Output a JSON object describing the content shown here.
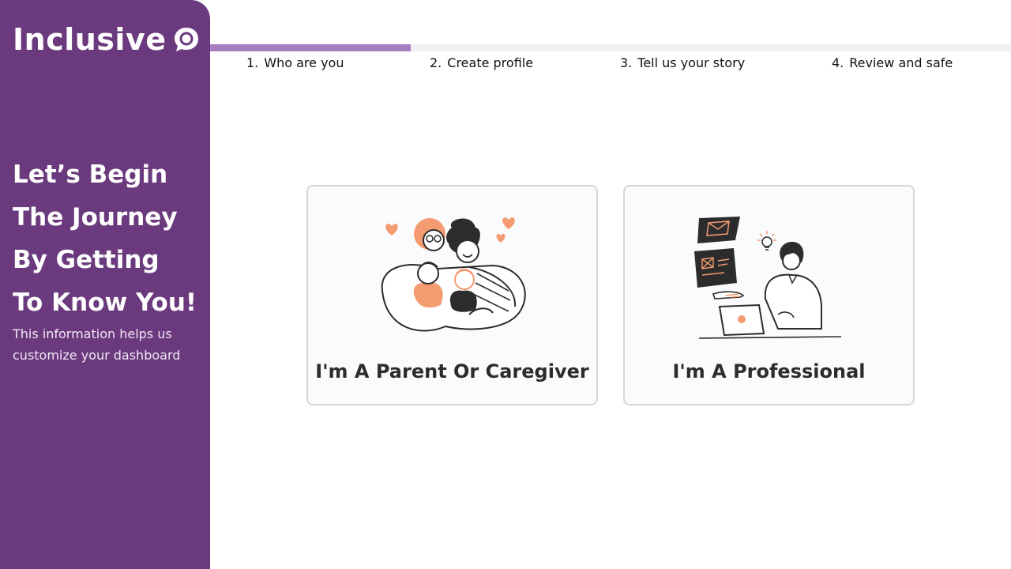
{
  "brand": {
    "name": "Inclusive",
    "icon": "chat-bubble-icon"
  },
  "intro": {
    "headline_lines": [
      "Let’s Begin",
      "The Journey",
      "By Getting",
      "To Know You!"
    ],
    "subtext_lines": [
      "This information helps us",
      "customize your dashboard"
    ]
  },
  "progress": {
    "fraction": 0.25,
    "current_step": 1
  },
  "steps": [
    {
      "number": "1.",
      "label": "Who are you"
    },
    {
      "number": "2.",
      "label": "Create profile"
    },
    {
      "number": "3.",
      "label": "Tell us your story"
    },
    {
      "number": "4.",
      "label": "Review and safe"
    }
  ],
  "options": [
    {
      "label": "I'm A Parent Or Caregiver",
      "icon": "family-illustration"
    },
    {
      "label": "I'm A Professional",
      "icon": "professional-laptop-illustration"
    }
  ],
  "colors": {
    "sidebar": "#6b3a7e",
    "progress": "#a77dc2",
    "accent": "#f49b72"
  }
}
